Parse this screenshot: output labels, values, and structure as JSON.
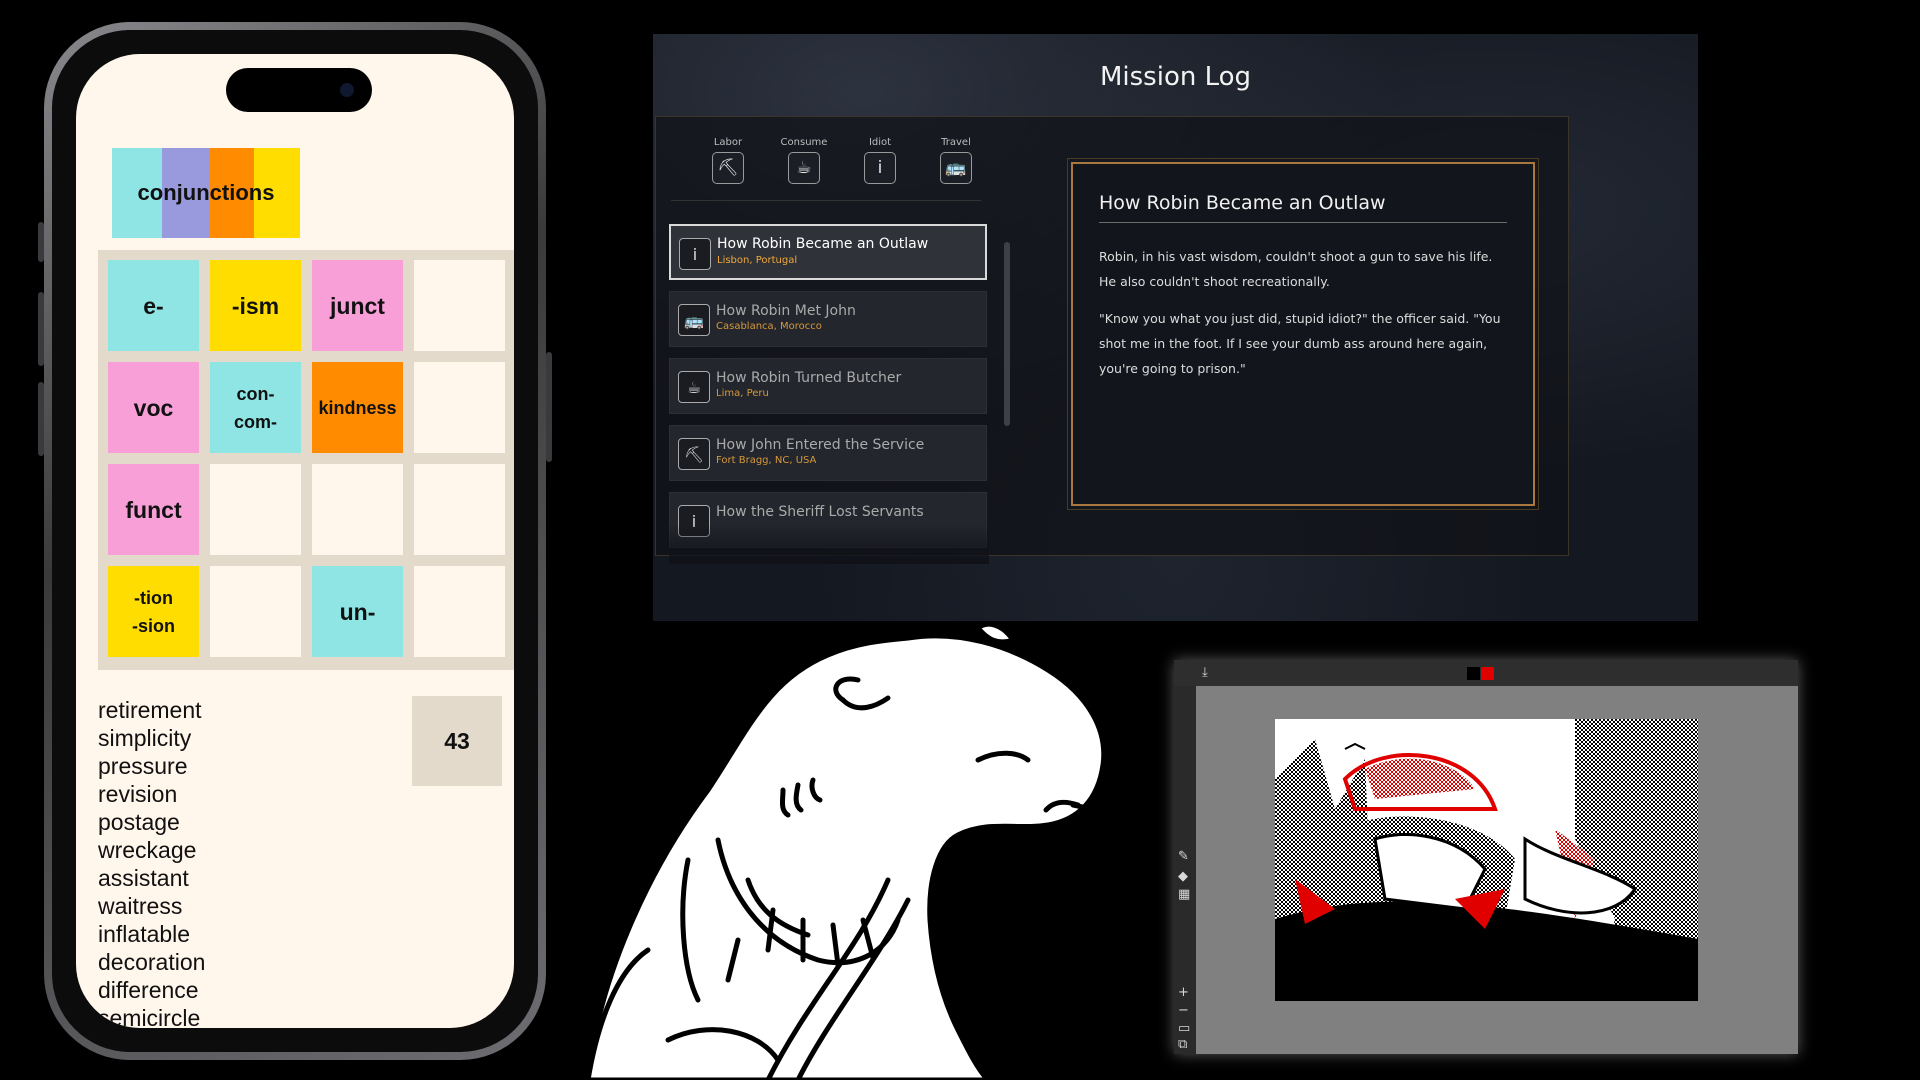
{
  "word_game": {
    "category": "conjunctions",
    "category_colors": [
      "#8fe4e4",
      "#9999de",
      "#ff8c00",
      "#ffdd00"
    ],
    "tiles": [
      {
        "text": "e-",
        "color": "#8fe4e4"
      },
      {
        "text": "-ism",
        "color": "#ffdd00"
      },
      {
        "text": "junct",
        "color": "#f89fd8"
      },
      {
        "text": "",
        "color": "#fff6ec"
      },
      {
        "text": "voc",
        "color": "#f89fd8"
      },
      {
        "text": "con-\ncom-",
        "color": "#8fe4e4"
      },
      {
        "text": "kindness",
        "color": "#ff8c00"
      },
      {
        "text": "",
        "color": "#fff6ec"
      },
      {
        "text": "funct",
        "color": "#f89fd8"
      },
      {
        "text": "",
        "color": "#fff6ec"
      },
      {
        "text": "",
        "color": "#fff6ec"
      },
      {
        "text": "",
        "color": "#fff6ec"
      },
      {
        "text": "-tion\n-sion",
        "color": "#ffdd00"
      },
      {
        "text": "",
        "color": "#fff6ec"
      },
      {
        "text": "un-",
        "color": "#8fe4e4"
      },
      {
        "text": "",
        "color": "#fff6ec"
      }
    ],
    "words": [
      "retirement",
      "simplicity",
      "pressure",
      "revision",
      "postage",
      "wreckage",
      "assistant",
      "waitress",
      "inflatable",
      "decoration",
      "difference",
      "semicircle"
    ],
    "score": "43"
  },
  "mission_log": {
    "title": "Mission Log",
    "categories": [
      {
        "label": "Labor",
        "icon": "shovel-icon",
        "glyph": "⛏"
      },
      {
        "label": "Consume",
        "icon": "cup-icon",
        "glyph": "☕"
      },
      {
        "label": "Idiot",
        "icon": "info-icon",
        "glyph": "i"
      },
      {
        "label": "Travel",
        "icon": "bus-icon",
        "glyph": "🚌"
      }
    ],
    "entries": [
      {
        "title": "How Robin Became an Outlaw",
        "location": "Lisbon, Portugal",
        "icon": "info-icon",
        "glyph": "i",
        "selected": true
      },
      {
        "title": "How Robin Met John",
        "location": "Casablanca, Morocco",
        "icon": "bus-icon",
        "glyph": "🚌",
        "selected": false
      },
      {
        "title": "How Robin Turned Butcher",
        "location": "Lima, Peru",
        "icon": "cup-icon",
        "glyph": "☕",
        "selected": false
      },
      {
        "title": "How John Entered the Service",
        "location": "Fort Bragg, NC, USA",
        "icon": "shovel-icon",
        "glyph": "⛏",
        "selected": false
      },
      {
        "title": "How the Sheriff Lost Servants",
        "location": "",
        "icon": "info-icon",
        "glyph": "i",
        "selected": false
      }
    ],
    "detail": {
      "title": "How Robin Became an Outlaw",
      "paragraphs": [
        "Robin, in his vast wisdom, couldn't shoot a gun to save his life. He also couldn't shoot recreationally.",
        "\"Know you what you just did, stupid idiot?\" the officer said. \"You shot me in the foot. If I see your dumb ass around here again, you're going to prison.\""
      ]
    },
    "accent": "#f0a83a"
  },
  "pixel_editor": {
    "palette": [
      "#000000",
      "#e00000"
    ],
    "tools": [
      "pencil-icon",
      "eraser-icon",
      "dither-icon"
    ],
    "zoom_tools": [
      "zoom-in-icon",
      "zoom-out-icon",
      "frame-icon",
      "layers-icon"
    ]
  }
}
